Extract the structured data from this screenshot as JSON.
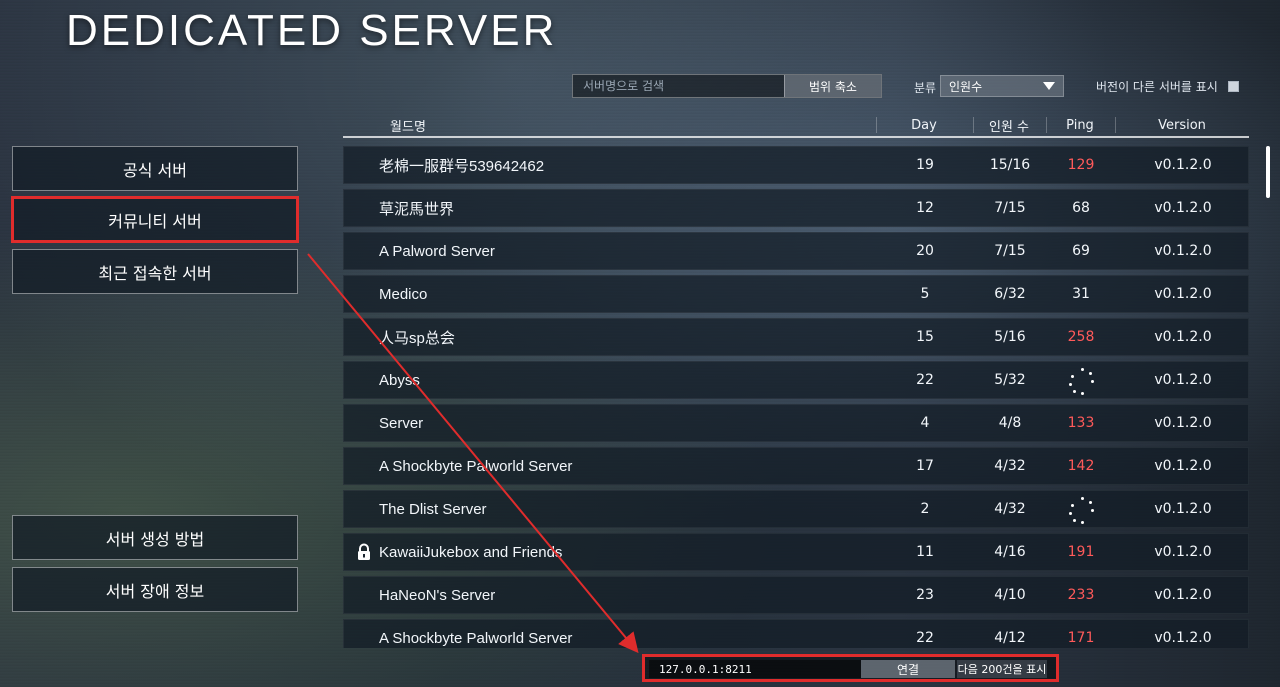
{
  "title": "DEDICATED SERVER",
  "search": {
    "placeholder": "서버명으로 검색",
    "narrow_label": "범위 축소"
  },
  "sort": {
    "label": "분류",
    "selected": "인원수"
  },
  "version_toggle": {
    "label": "버전이 다른 서버를 표시"
  },
  "columns": {
    "world": "월드명",
    "day": "Day",
    "players": "인원 수",
    "ping": "Ping",
    "version": "Version"
  },
  "rows": [
    {
      "name": "老棉一服群号539642462",
      "day": "19",
      "players": "15/16",
      "ping": "129",
      "ping_state": "red",
      "version": "v0.1.2.0",
      "locked": false
    },
    {
      "name": "草泥馬世界",
      "day": "12",
      "players": "7/15",
      "ping": "68",
      "ping_state": "normal",
      "version": "v0.1.2.0",
      "locked": false
    },
    {
      "name": "A Palword Server",
      "day": "20",
      "players": "7/15",
      "ping": "69",
      "ping_state": "normal",
      "version": "v0.1.2.0",
      "locked": false
    },
    {
      "name": "Medico",
      "day": "5",
      "players": "6/32",
      "ping": "31",
      "ping_state": "normal",
      "version": "v0.1.2.0",
      "locked": false
    },
    {
      "name": "人马sp总会",
      "day": "15",
      "players": "5/16",
      "ping": "258",
      "ping_state": "red",
      "version": "v0.1.2.0",
      "locked": false
    },
    {
      "name": "Abyss",
      "day": "22",
      "players": "5/32",
      "ping": "",
      "ping_state": "loading",
      "version": "v0.1.2.0",
      "locked": false
    },
    {
      "name": "Server",
      "day": "4",
      "players": "4/8",
      "ping": "133",
      "ping_state": "red",
      "version": "v0.1.2.0",
      "locked": false
    },
    {
      "name": "A Shockbyte Palworld Server",
      "day": "17",
      "players": "4/32",
      "ping": "142",
      "ping_state": "red",
      "version": "v0.1.2.0",
      "locked": false
    },
    {
      "name": "The Dlist Server",
      "day": "2",
      "players": "4/32",
      "ping": "",
      "ping_state": "loading",
      "version": "v0.1.2.0",
      "locked": false
    },
    {
      "name": "KawaiiJukebox and Friends",
      "day": "11",
      "players": "4/16",
      "ping": "191",
      "ping_state": "red",
      "version": "v0.1.2.0",
      "locked": true
    },
    {
      "name": "HaNeoN's Server",
      "day": "23",
      "players": "4/10",
      "ping": "233",
      "ping_state": "red",
      "version": "v0.1.2.0",
      "locked": false
    },
    {
      "name": "A Shockbyte Palworld Server",
      "day": "22",
      "players": "4/12",
      "ping": "171",
      "ping_state": "red",
      "version": "v0.1.2.0",
      "locked": false
    }
  ],
  "sidebar": {
    "official": "공식 서버",
    "community": "커뮤니티 서버",
    "recent": "최근 접속한 서버",
    "howto": "서버 생성 방법",
    "trouble": "서버 장애 정보",
    "active_item": "community"
  },
  "bottom": {
    "address": "127.0.0.1:8211",
    "connect_label": "연결",
    "next_label": "다음 200건을 표시"
  },
  "colors": {
    "annotation_red": "#e02c2c",
    "ping_red": "#ff5a5a"
  }
}
